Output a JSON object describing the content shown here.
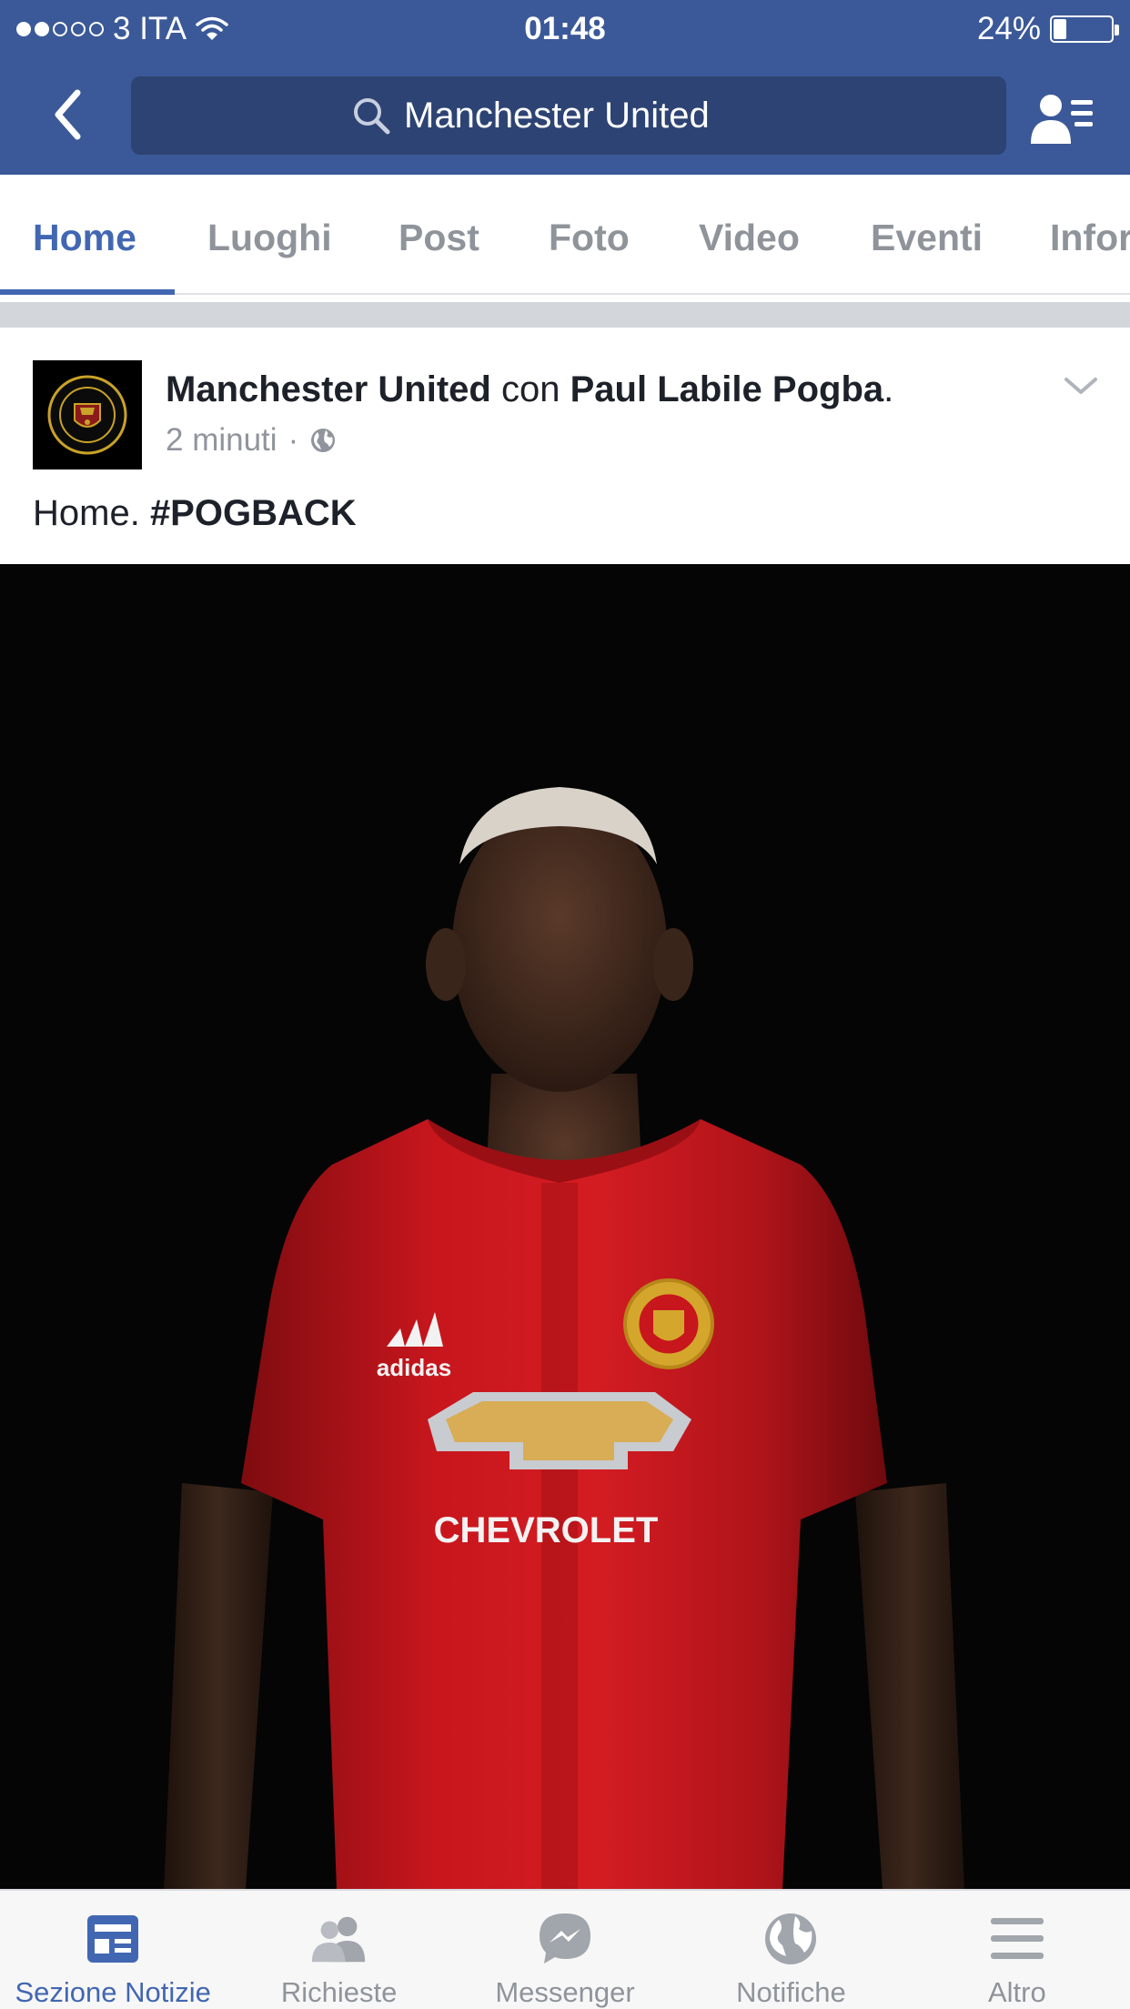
{
  "status_bar": {
    "carrier": "3 ITA",
    "signal_bars_filled": 2,
    "signal_bars_total": 5,
    "time": "01:48",
    "battery": "24%",
    "battery_level": 0.24
  },
  "header": {
    "search_value": "Manchester United",
    "icons": [
      "back-chevron-icon",
      "search-icon",
      "person-list-icon"
    ]
  },
  "tabs": [
    {
      "label": "Home",
      "active": true
    },
    {
      "label": "Luoghi"
    },
    {
      "label": "Post"
    },
    {
      "label": "Foto"
    },
    {
      "label": "Video"
    },
    {
      "label": "Eventi"
    },
    {
      "label": "Infor"
    }
  ],
  "post": {
    "author": "Manchester United",
    "connector": "con",
    "tagged": "Paul Labile Pogba",
    "period": ".",
    "time": "2 minuti",
    "separator": "·",
    "caption_text": "Home.",
    "caption_hashtag": "#POGBACK",
    "photo_texts": [
      "adidas",
      "CHEVROLET"
    ]
  },
  "bottom_nav": [
    {
      "label": "Sezione Notizie",
      "icon": "news-feed-icon",
      "active": true
    },
    {
      "label": "Richieste",
      "icon": "friend-requests-icon"
    },
    {
      "label": "Messenger",
      "icon": "messenger-icon"
    },
    {
      "label": "Notifiche",
      "icon": "globe-notifications-icon"
    },
    {
      "label": "Altro",
      "icon": "menu-icon"
    }
  ],
  "colors": {
    "brand": "#3b5998",
    "search_bg": "#2d4373",
    "active": "#4267b2",
    "inactive": "#8f949b",
    "jersey": "#c8161d"
  }
}
